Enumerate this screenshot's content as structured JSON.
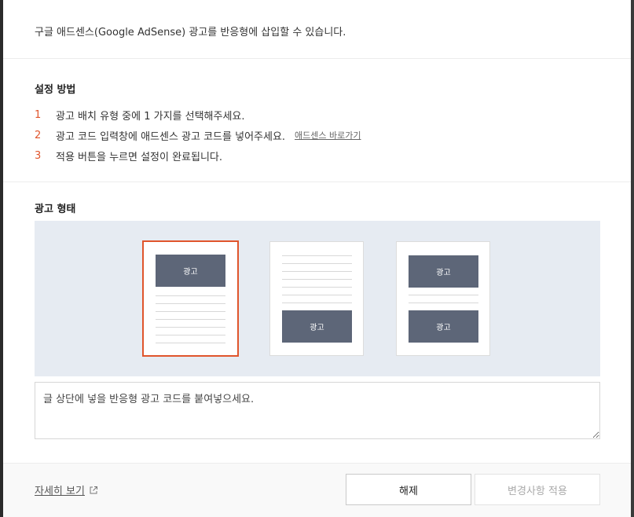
{
  "intro_text": "구글 애드센스(Google AdSense) 광고를 반응형에 삽입할 수 있습니다.",
  "setup": {
    "heading": "설정 방법",
    "steps": [
      {
        "num": "1",
        "text": "광고 배치 유형 중에 1 가지를 선택해주세요."
      },
      {
        "num": "2",
        "text": "광고 코드 입력창에 애드센스 광고 코드를 넣어주세요.",
        "link": "애드센스 바로가기"
      },
      {
        "num": "3",
        "text": "적용 버튼을 누르면 설정이 완료됩니다."
      }
    ]
  },
  "ad_type": {
    "heading": "광고 형태",
    "ad_label": "광고",
    "options": [
      "top",
      "bottom",
      "top-and-bottom"
    ],
    "selected": "top"
  },
  "code_input": {
    "placeholder": "글 상단에 넣을 반응형 광고 코드를 붙여넣으세요.",
    "value": ""
  },
  "footer": {
    "detail_link": "자세히 보기",
    "release_button": "해제",
    "apply_button": "변경사항 적용"
  },
  "colors": {
    "accent": "#e0552c",
    "ad_block": "#5d6678",
    "preview_bg": "#e6ebf2"
  },
  "icons": {
    "external_link": "external-link-icon"
  }
}
